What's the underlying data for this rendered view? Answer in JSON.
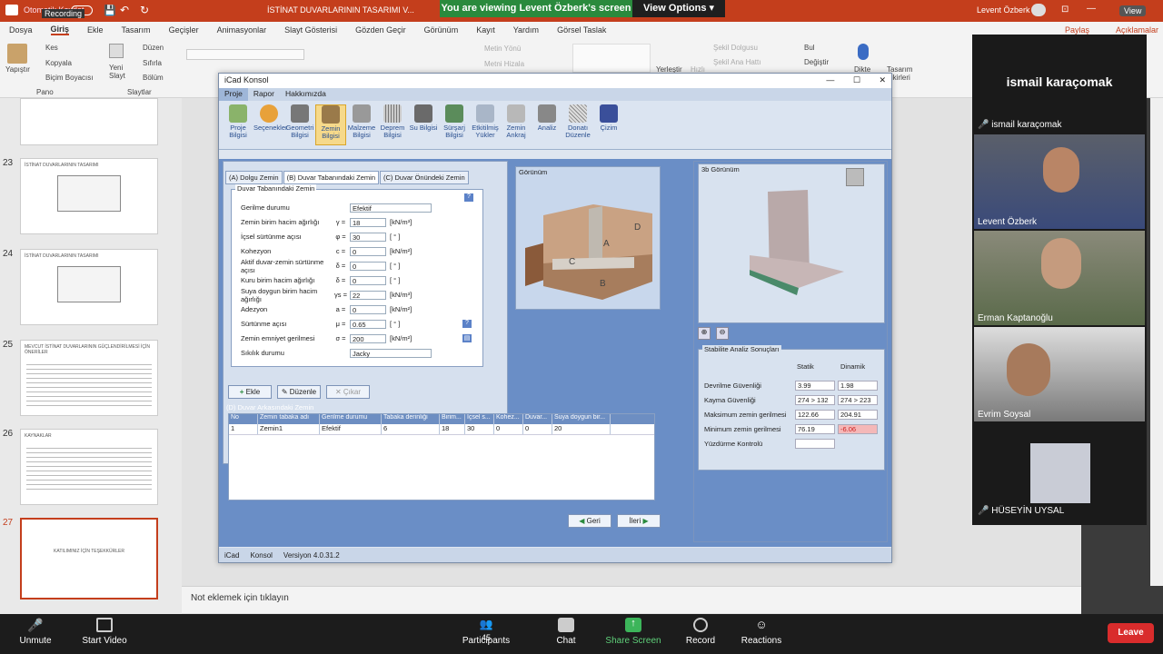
{
  "pp": {
    "autosave": "Otomatik Kaydet",
    "recording": "Recording",
    "doc_title": "İSTİNAT DUVARLARININ TASARIMI V...",
    "user": "Levent Özberk",
    "view_btn": "View",
    "share_banner": "You are viewing Levent Özberk's screen",
    "view_options": "View Options",
    "menu": [
      "Dosya",
      "Giriş",
      "Ekle",
      "Tasarım",
      "Geçişler",
      "Animasyonlar",
      "Slayt Gösterisi",
      "Gözden Geçir",
      "Görünüm",
      "Kayıt",
      "Yardım",
      "Görsel Taslak"
    ],
    "share": "Paylaş",
    "comments": "Açıklamalar",
    "ribbon": {
      "paste": "Yapıştır",
      "cut": "Kes",
      "copy": "Kopyala",
      "format_painter": "Biçim Boyacısı",
      "clipboard": "Pano",
      "new_slide": "Yeni Slayt",
      "layout": "Düzen",
      "reset": "Sıfırla",
      "section": "Bölüm",
      "slides": "Slaytlar",
      "text_direction": "Metin Yönü",
      "align_text": "Metni Hizala",
      "arrange": "Yerleştir",
      "quick_styles": "Hızlı",
      "shape_fill": "Şekil Dolgusu",
      "shape_outline": "Şekil Ana Hattı",
      "find": "Bul",
      "replace": "Değiştir",
      "dictate": "Dikte",
      "designer": "Tasarım Fikirleri"
    },
    "notes_placeholder": "Not eklemek için tıklayın",
    "slide_numbers": [
      "23",
      "24",
      "25",
      "26",
      "27"
    ],
    "slide_titles": [
      "İSTİNAT DUVARLARININ TASARIMI",
      "İSTİNAT DUVARLARININ TASARIMI",
      "MEVCUT İSTİNAT DUVARLARININ GÜÇLENDİRİLMESİ İÇİN ÖNERİLER",
      "KAYNAKLAR",
      "KATILIMINIZ İÇİN TEŞEKKÜRLER"
    ]
  },
  "icad": {
    "title": "iCad Konsol",
    "menu": [
      "Proje",
      "Rapor",
      "Hakkımızda"
    ],
    "tools": [
      "Proje Bilgisi",
      "Seçenekler",
      "Geometri Bilgisi",
      "Zemin Bilgisi",
      "Malzeme Bilgisi",
      "Deprem Bilgisi",
      "Su Bilgisi",
      "Sürşarj Bilgisi",
      "Etkitilmiş Yükler",
      "Zemin Ankraj",
      "Analiz",
      "Donatı Düzenle",
      "Çizim"
    ],
    "tabs": [
      "(A) Dolgu Zemin",
      "(B) Duvar Tabanındaki Zemin",
      "(C) Duvar Önündeki Zemin"
    ],
    "group_title": "Duvar Tabanındaki Zemin",
    "fields": [
      {
        "label": "Gerilme durumu",
        "sym": "",
        "value": "Efektif",
        "unit": "",
        "type": "select"
      },
      {
        "label": "Zemin birim hacim ağırlığı",
        "sym": "γ =",
        "value": "18",
        "unit": "[kN/m³]",
        "type": "input"
      },
      {
        "label": "İçsel sürtünme açısı",
        "sym": "φ =",
        "value": "30",
        "unit": "[ ° ]",
        "type": "input"
      },
      {
        "label": "Kohezyon",
        "sym": "c =",
        "value": "0",
        "unit": "[kN/m²]",
        "type": "input"
      },
      {
        "label": "Aktif duvar-zemin sürtünme açısı",
        "sym": "δ =",
        "value": "0",
        "unit": "[ ° ]",
        "type": "input"
      },
      {
        "label": "Kuru birim hacim ağırlığı",
        "sym": "δ =",
        "value": "0",
        "unit": "[ ° ]",
        "type": "input"
      },
      {
        "label": "Suya doygun birim hacim ağırlığı",
        "sym": "γs =",
        "value": "22",
        "unit": "[kN/m³]",
        "type": "input"
      },
      {
        "label": "Adezyon",
        "sym": "a =",
        "value": "0",
        "unit": "[kN/m²]",
        "type": "input"
      },
      {
        "label": "Sürtünme açısı",
        "sym": "μ =",
        "value": "0.65",
        "unit": "[ ° ]",
        "type": "input"
      },
      {
        "label": "Zemin emniyet gerilmesi",
        "sym": "σ =",
        "value": "200",
        "unit": "[kN/m²]",
        "type": "input"
      },
      {
        "label": "Sıkılık durumu",
        "sym": "",
        "value": "Jacky",
        "unit": "",
        "type": "select"
      }
    ],
    "btn_add": "Ekle",
    "btn_edit": "Düzenle",
    "btn_remove": "Çıkar",
    "table_title": "(D) Duvar Arkasındaki Zemin",
    "table_headers": [
      "No",
      "Zemin tabaka adı",
      "Gerilme durumu",
      "Tabaka derinliği",
      "Birim...",
      "İçsel s...",
      "Kohez...",
      "Duvar...",
      "Suya doygun bir..."
    ],
    "table_rows": [
      [
        "1",
        "Zemin1",
        "Efektif",
        "6",
        "18",
        "30",
        "0",
        "0",
        "20"
      ]
    ],
    "view_title": "Görünüm",
    "view_labels": [
      "A",
      "B",
      "C",
      "D"
    ],
    "view3d_title": "3b Görünüm",
    "btn_back": "Geri",
    "btn_next": "İleri",
    "stab_title": "Stabilite Analiz Sonuçları",
    "stab_cols": [
      "Statik",
      "Dinamik"
    ],
    "stab_rows": [
      {
        "label": "Devrilme Güvenliği",
        "s": "3.99",
        "d": "1.98"
      },
      {
        "label": "Kayma Güvenliği",
        "s": "274 > 132",
        "d": "274 > 223"
      },
      {
        "label": "Maksimum zemin gerilmesi",
        "s": "122.66",
        "d": "204.91"
      },
      {
        "label": "Minimum zemin gerilmesi",
        "s": "76.19",
        "d": "-6.06"
      },
      {
        "label": "Yüzdürme Kontrolü",
        "s": "",
        "d": ""
      }
    ],
    "status": [
      "iCad",
      "Konsol",
      "Versiyon 4.0.31.2"
    ]
  },
  "participants": {
    "header": "ismail karaçomak",
    "tiles": [
      "ismail karaçomak",
      "Levent Özberk",
      "Erman Kaptanoğlu",
      "Evrim Soysal",
      "HÜSEYİN UYSAL"
    ]
  },
  "zoom": {
    "unmute": "Unmute",
    "start_video": "Start Video",
    "participants": "Participants",
    "participants_count": "45",
    "chat": "Chat",
    "share_screen": "Share Screen",
    "record": "Record",
    "reactions": "Reactions",
    "leave": "Leave"
  },
  "colors": {
    "accent": "#c43e1c",
    "share_green": "#2a8a3d",
    "leave_red": "#d92c2c",
    "icad_blue": "#6a8ec6"
  }
}
